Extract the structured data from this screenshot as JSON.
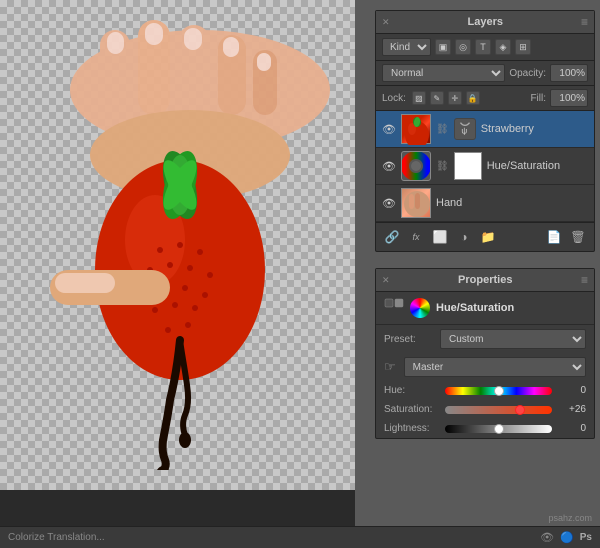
{
  "canvas": {
    "bg_note": "checkerboard transparency background with strawberry image"
  },
  "layers_panel": {
    "title": "Layers",
    "close_label": "×",
    "menu_label": "≡",
    "kind_label": "Kind",
    "blend_mode": "Normal",
    "opacity_label": "Opacity:",
    "opacity_value": "100%",
    "lock_label": "Lock:",
    "fill_label": "Fill:",
    "fill_value": "100%",
    "layers": [
      {
        "name": "Strawberry",
        "visible": true,
        "active": true,
        "has_mask": true
      },
      {
        "name": "Hue/Saturation",
        "visible": true,
        "active": false,
        "has_mask": true
      },
      {
        "name": "Hand",
        "visible": true,
        "active": false,
        "has_mask": false
      }
    ],
    "toolbar_icons": [
      "link-icon",
      "fx-icon",
      "mask-icon",
      "shape-icon",
      "folder-icon",
      "delete-icon"
    ]
  },
  "properties_panel": {
    "title": "Properties",
    "close_label": "×",
    "menu_label": "≡",
    "section_title": "Hue/Saturation",
    "preset_label": "Preset:",
    "preset_value": "Custom",
    "channel_value": "Master",
    "hue_label": "Hue:",
    "hue_value": "0",
    "hue_thumb_pct": 50,
    "saturation_label": "Saturation:",
    "saturation_value": "+26",
    "saturation_thumb_pct": 70,
    "lightness_label": "Lightness:",
    "lightness_value": "0",
    "lightness_thumb_pct": 50
  },
  "status_bar": {
    "text": "Colorize  Translation...",
    "icons": [
      "eye-icon",
      "info-icon",
      "ps-logo"
    ]
  },
  "watermark": {
    "text": "psahz.com"
  }
}
